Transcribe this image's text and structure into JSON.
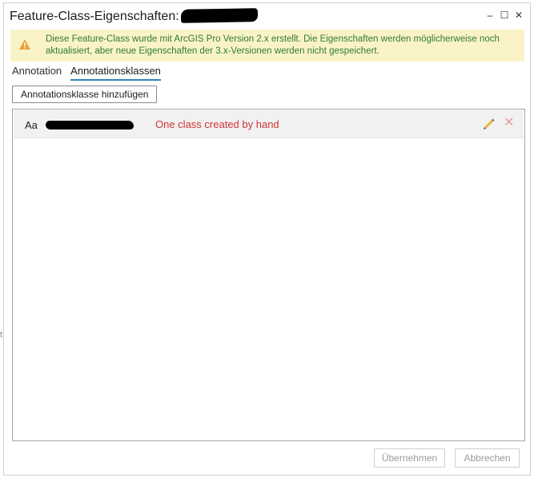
{
  "window": {
    "title": "Feature-Class-Eigenschaften:",
    "controls": {
      "minimize": "–",
      "maximize": "☐",
      "close": "✕"
    }
  },
  "warning": {
    "text": "Diese Feature-Class wurde mit ArcGIS Pro Version 2.x erstellt. Die Eigenschaften werden möglicherweise noch aktualisiert, aber neue Eigenschaften der 3.x-Versionen werden nicht gespeichert.",
    "icon": "warning-icon",
    "color": "#2e7d32",
    "background": "#fbf3c8"
  },
  "tabs": [
    {
      "label": "Annotation",
      "active": false
    },
    {
      "label": "Annotationsklassen",
      "active": true
    }
  ],
  "toolbar": {
    "add_label": "Annotationsklasse hinzufügen"
  },
  "classes": [
    {
      "icon_text": "Aa",
      "note": "One class created by hand",
      "note_color": "#d13438"
    }
  ],
  "footer": {
    "apply_label": "Übernehmen",
    "cancel_label": "Abbrechen"
  },
  "accent": "#2d84b9"
}
